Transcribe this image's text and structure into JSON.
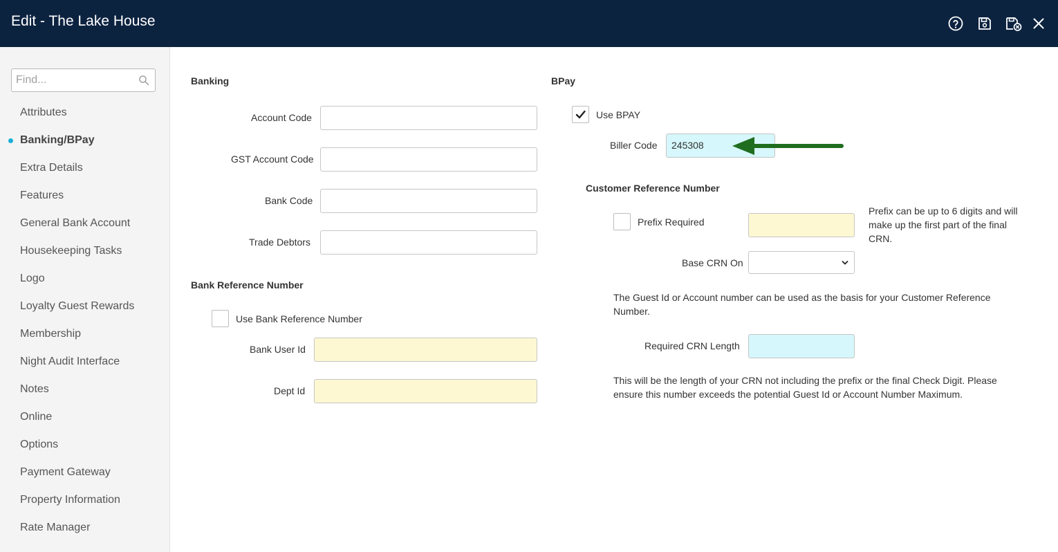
{
  "header": {
    "title": "Edit - The Lake House",
    "icons": [
      "help-icon",
      "save-icon",
      "save-close-icon",
      "close-icon"
    ]
  },
  "sidebar": {
    "search_placeholder": "Find...",
    "items": [
      {
        "label": "Attributes"
      },
      {
        "label": "Banking/BPay",
        "active": true
      },
      {
        "label": "Extra Details"
      },
      {
        "label": "Features"
      },
      {
        "label": "General Bank Account"
      },
      {
        "label": "Housekeeping Tasks"
      },
      {
        "label": "Logo"
      },
      {
        "label": "Loyalty Guest Rewards"
      },
      {
        "label": "Membership"
      },
      {
        "label": "Night Audit Interface"
      },
      {
        "label": "Notes"
      },
      {
        "label": "Online"
      },
      {
        "label": "Options"
      },
      {
        "label": "Payment Gateway"
      },
      {
        "label": "Property Information"
      },
      {
        "label": "Rate Manager"
      }
    ]
  },
  "banking": {
    "heading": "Banking",
    "account_code_label": "Account Code",
    "account_code_value": "",
    "gst_account_code_label": "GST Account Code",
    "gst_account_code_value": "",
    "bank_code_label": "Bank Code",
    "bank_code_value": "",
    "trade_debtors_label": "Trade Debtors",
    "trade_debtors_value": ""
  },
  "bank_reference": {
    "heading": "Bank Reference Number",
    "use_label": "Use Bank Reference Number",
    "use_checked": false,
    "bank_user_id_label": "Bank User Id",
    "bank_user_id_value": "",
    "dept_id_label": "Dept Id",
    "dept_id_value": ""
  },
  "bpay": {
    "heading": "BPay",
    "use_label": "Use BPAY",
    "use_checked": true,
    "biller_code_label": "Biller Code",
    "biller_code_value": "245308"
  },
  "crn": {
    "heading": "Customer Reference Number",
    "prefix_label": "Prefix Required",
    "prefix_checked": false,
    "prefix_value": "",
    "prefix_note": "Prefix can be up to 6 digits and will make up the first part of the final CRN.",
    "base_label": "Base CRN On",
    "base_value": "",
    "base_note": "The Guest Id or Account number can be used as the basis for your Customer Reference Number.",
    "length_label": "Required CRN Length",
    "length_value": "",
    "length_note": "This will be the length of your CRN not including the prefix or the final Check Digit. Please ensure this number exceeds the potential Guest Id or Account Number Maximum."
  },
  "colors": {
    "header_bg": "#0c2340",
    "active_dot": "#1ab0d8",
    "required_field": "#fdf8d2",
    "highlight_field": "#d6f7fb",
    "annotation_arrow": "#1f6e1f"
  }
}
